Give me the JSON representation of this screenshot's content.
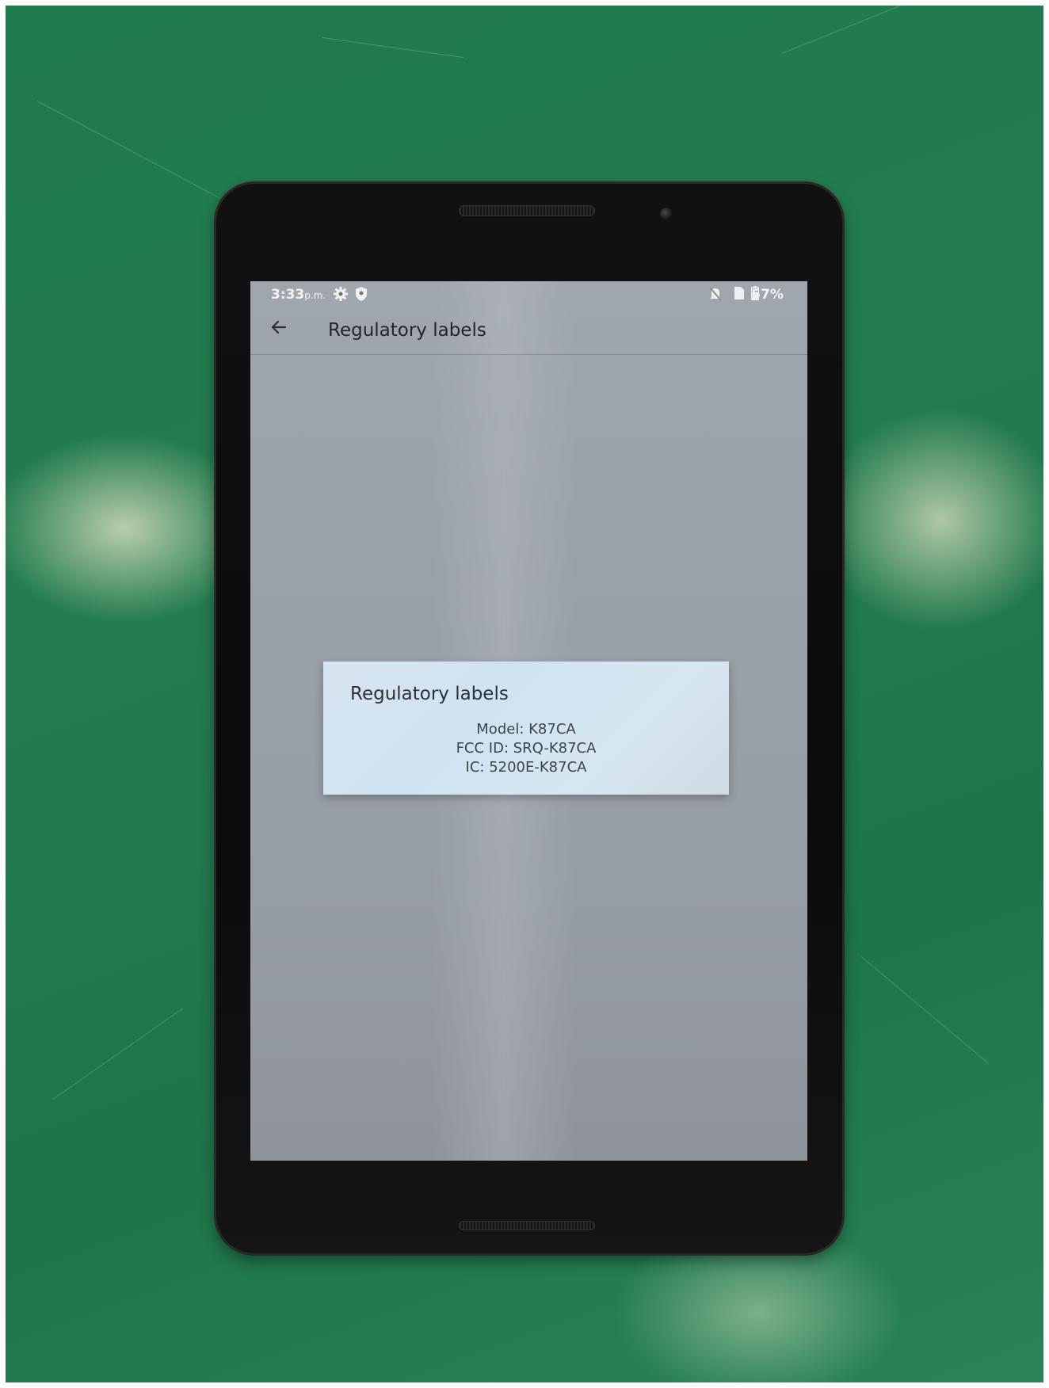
{
  "status_bar": {
    "time": "3:33",
    "time_suffix": "p.m.",
    "battery": "57%",
    "icons": [
      "settings-gear-icon",
      "shield-icon",
      "mute-icon",
      "sim-icon",
      "battery-icon"
    ]
  },
  "app_bar": {
    "back_icon": "back-arrow-icon",
    "title": "Regulatory labels"
  },
  "dialog": {
    "title": "Regulatory labels",
    "lines": [
      "Model: K87CA",
      "FCC ID: SRQ-K87CA",
      "IC: 5200E-K87CA"
    ]
  }
}
